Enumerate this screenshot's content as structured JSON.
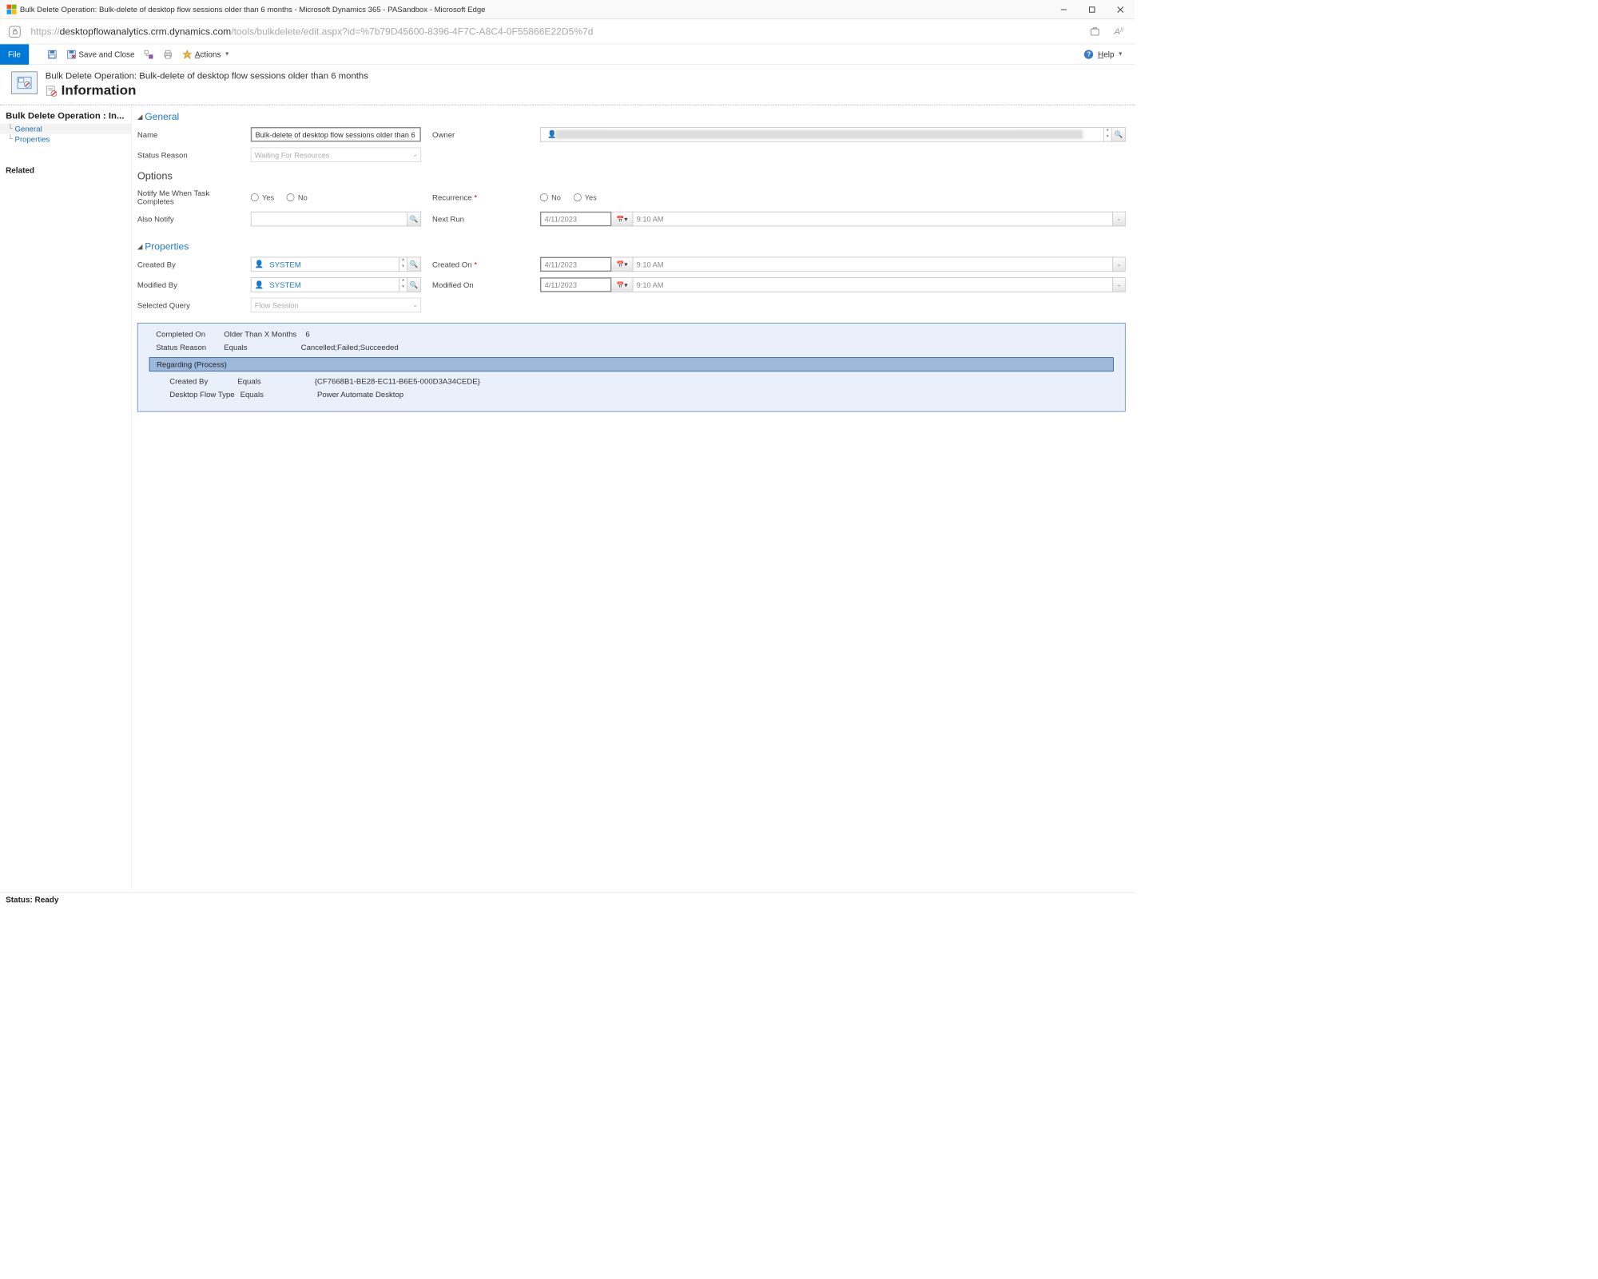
{
  "window": {
    "title": "Bulk Delete Operation: Bulk-delete of desktop flow sessions older than 6 months - Microsoft Dynamics 365 - PASandbox - Microsoft Edge"
  },
  "address": {
    "protocol": "https://",
    "domain": "desktopflowanalytics.crm.dynamics.com",
    "path": "/tools/bulkdelete/edit.aspx?id=%7b79D45600-8396-4F7C-A8C4-0F55866E22D5%7d"
  },
  "ribbon": {
    "file": "File",
    "saveClose": "Save and Close",
    "actions": "Actions",
    "help": "Help"
  },
  "pageHeader": {
    "line1": "Bulk Delete Operation: Bulk-delete of desktop flow sessions older than 6 months",
    "line2": "Information"
  },
  "sidebar": {
    "title": "Bulk Delete Operation : In...",
    "items": [
      {
        "label": "General"
      },
      {
        "label": "Properties"
      }
    ],
    "related": "Related"
  },
  "sections": {
    "general": "General",
    "options": "Options",
    "properties": "Properties"
  },
  "labels": {
    "name": "Name",
    "owner": "Owner",
    "statusReason": "Status Reason",
    "notify": "Notify Me When Task Completes",
    "recurrence": "Recurrence",
    "alsoNotify": "Also Notify",
    "nextRun": "Next Run",
    "createdBy": "Created By",
    "createdOn": "Created On",
    "modifiedBy": "Modified By",
    "modifiedOn": "Modified On",
    "selectedQuery": "Selected Query",
    "yes": "Yes",
    "no": "No"
  },
  "values": {
    "name": "Bulk-delete of desktop flow sessions older than 6 ",
    "statusReason": "Waiting For Resources",
    "nextRunDate": "4/11/2023",
    "nextRunTime": "9:10 AM",
    "createdBy": "SYSTEM",
    "createdOnDate": "4/11/2023",
    "createdOnTime": "9:10 AM",
    "modifiedBy": "SYSTEM",
    "modifiedOnDate": "4/11/2023",
    "modifiedOnTime": "9:10 AM",
    "selectedQuery": "Flow Session"
  },
  "query": {
    "rows": [
      {
        "field": "Completed On",
        "op": "Older Than X Months",
        "val": "6"
      },
      {
        "field": "Status Reason",
        "op": "Equals",
        "val": "Cancelled;Failed;Succeeded"
      }
    ],
    "groupHeader": "Regarding (Process)",
    "subrows": [
      {
        "field": "Created By",
        "op": "Equals",
        "val": "{CF7668B1-BE28-EC11-B6E5-000D3A34CEDE}"
      },
      {
        "field": "Desktop Flow Type",
        "op": "Equals",
        "val": "Power Automate Desktop"
      }
    ]
  },
  "status": "Status: Ready"
}
